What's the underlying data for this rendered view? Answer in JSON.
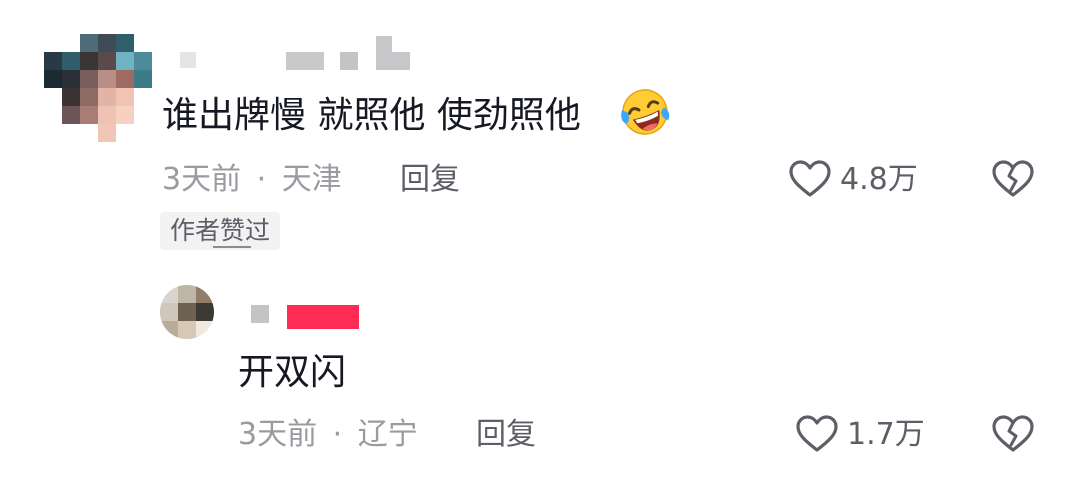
{
  "comment": {
    "text": "谁出牌慢 就照他 使劲照他",
    "emoji": "rofl-face",
    "time": "3天前",
    "separator": "·",
    "location": "天津",
    "reply_label": "回复",
    "like_count": "4.8万",
    "badge": "作者赞过"
  },
  "reply": {
    "text": "开双闪",
    "time": "3天前",
    "separator": "·",
    "location": "辽宁",
    "reply_label": "回复",
    "like_count": "1.7万"
  },
  "icons": {
    "like": "heart-outline-icon",
    "dislike": "broken-heart-icon"
  },
  "colors": {
    "text_primary": "#161823",
    "text_secondary": "#9a9ba0",
    "action": "#5d5f66",
    "username_mask_accent": "#fe2c55",
    "badge_bg": "#f2f2f3"
  }
}
